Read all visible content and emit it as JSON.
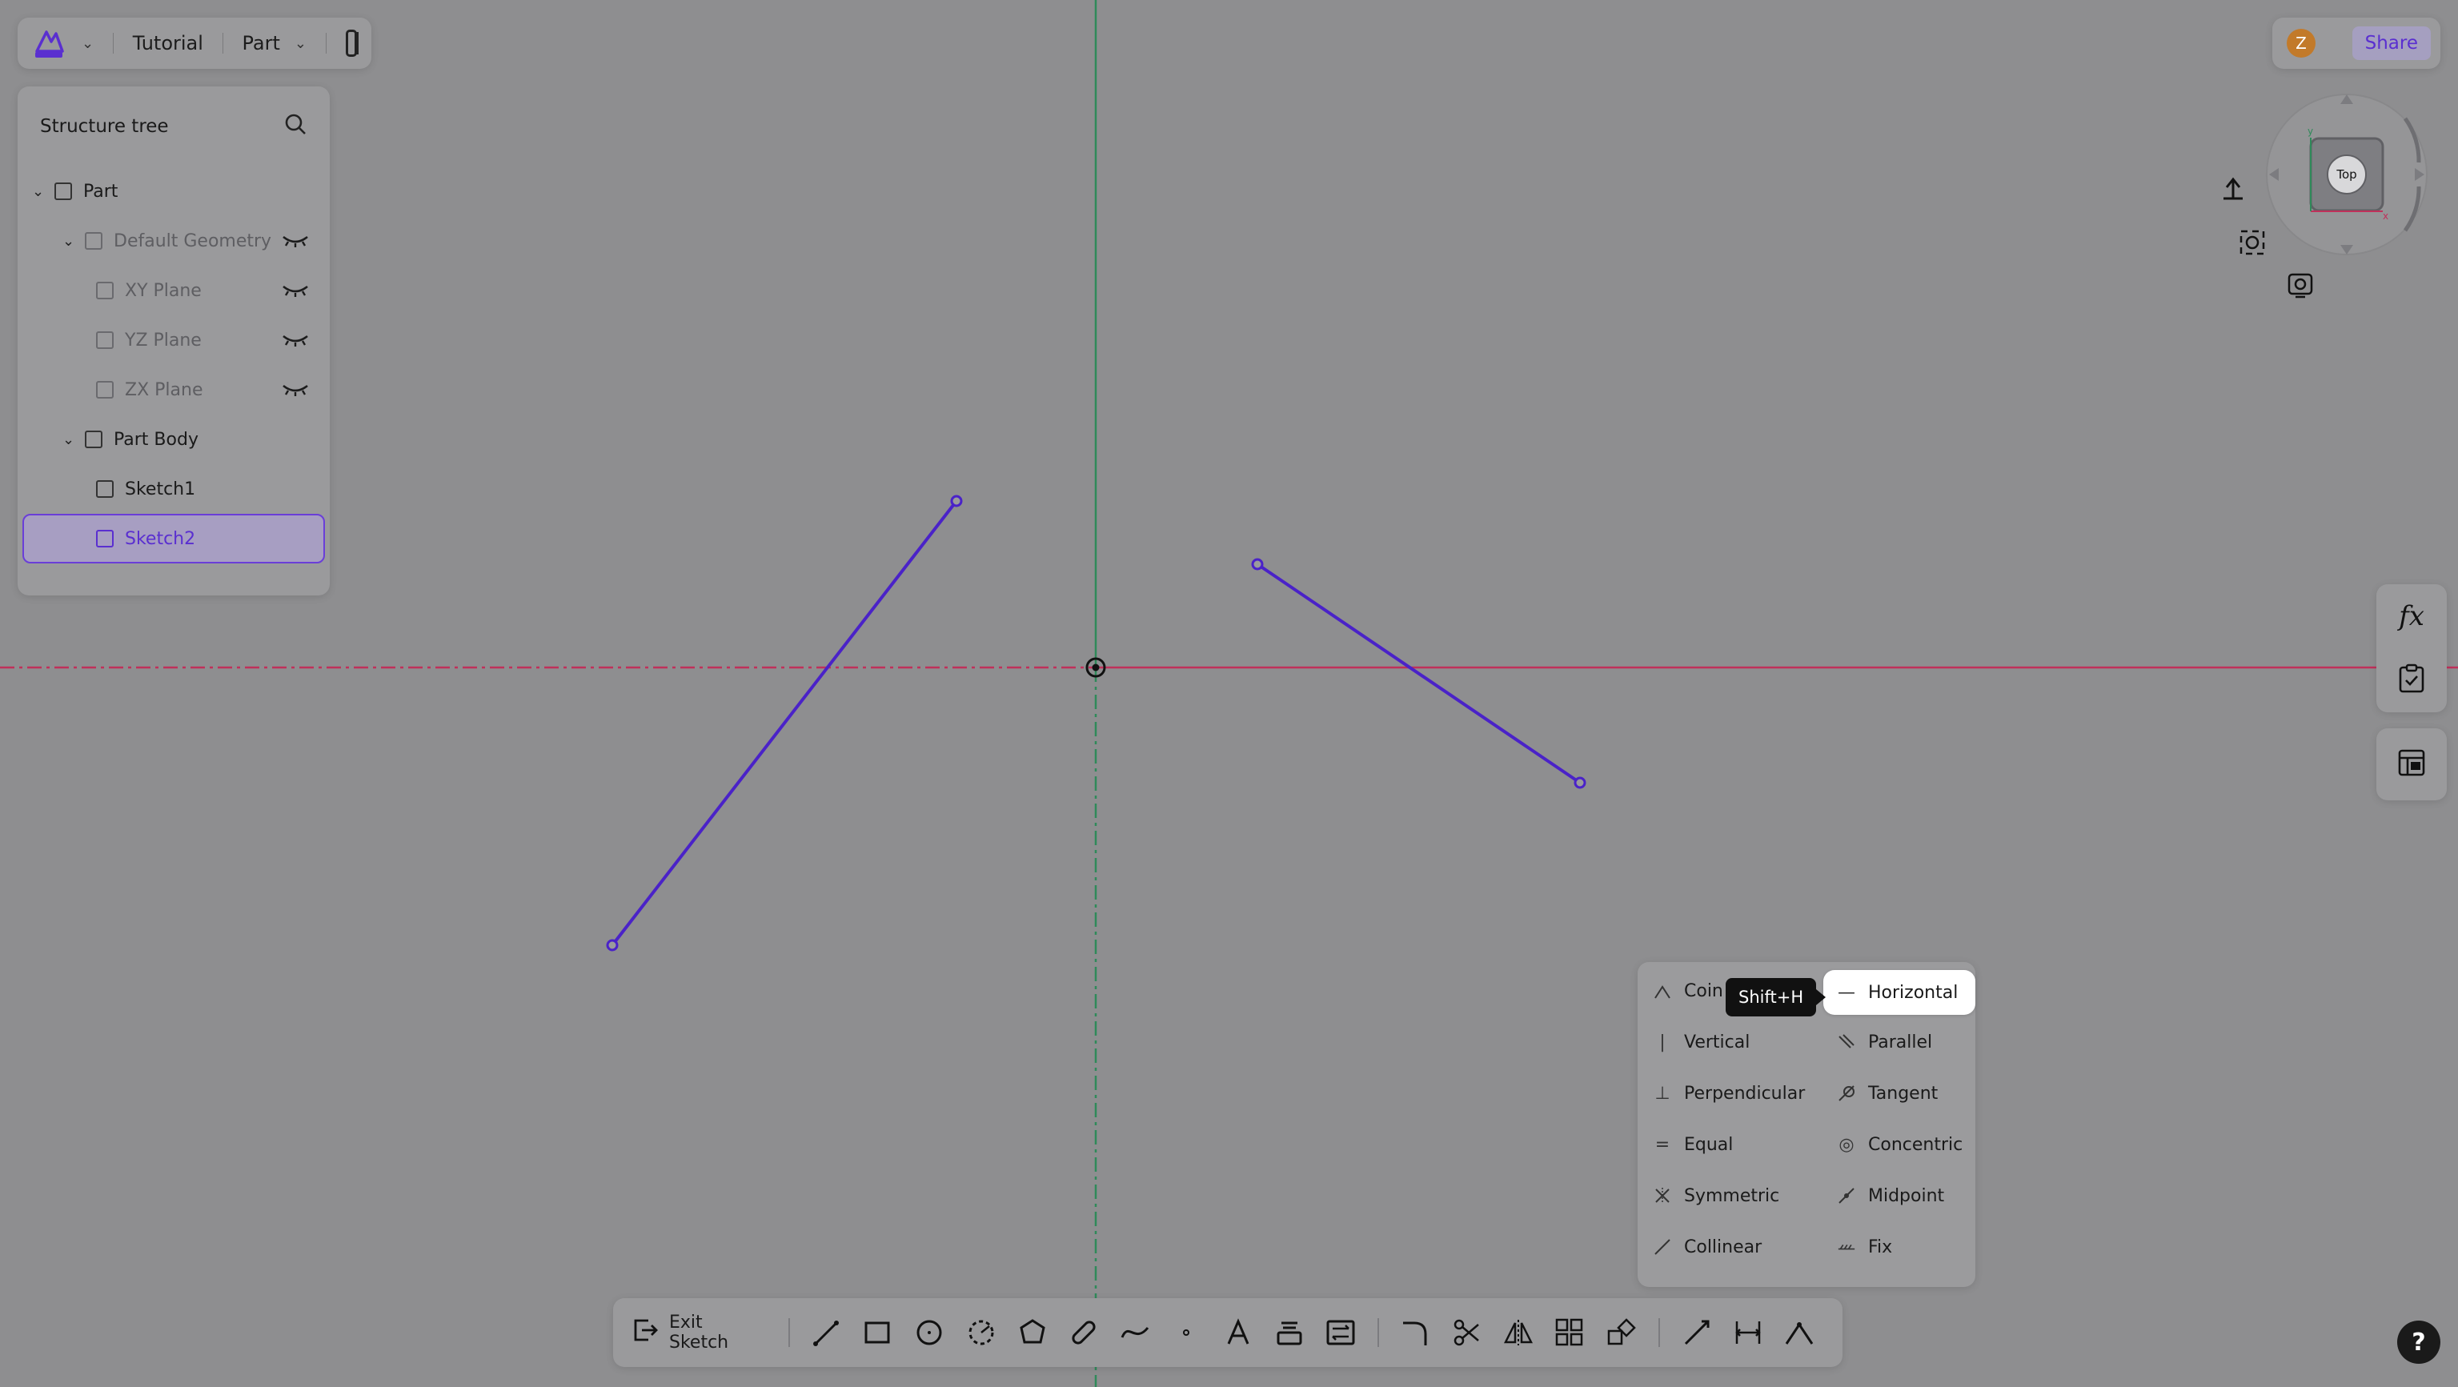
{
  "topbar": {
    "project": "Tutorial",
    "mode": "Part"
  },
  "tree": {
    "title": "Structure tree",
    "items": [
      {
        "label": "Part",
        "level": 0,
        "state": "normal"
      },
      {
        "label": "Default Geometry",
        "level": 1,
        "state": "dim"
      },
      {
        "label": "XY Plane",
        "level": 2,
        "state": "dim"
      },
      {
        "label": "YZ Plane",
        "level": 2,
        "state": "dim"
      },
      {
        "label": "ZX Plane",
        "level": 2,
        "state": "dim"
      },
      {
        "label": "Part Body",
        "level": 1,
        "state": "normal"
      },
      {
        "label": "Sketch1",
        "level": 2,
        "state": "normal"
      },
      {
        "label": "Sketch2",
        "level": 2,
        "state": "selected"
      }
    ]
  },
  "header": {
    "avatar_initial": "Z",
    "share_label": "Share"
  },
  "viewcube": {
    "face_label": "Top"
  },
  "constraint_menu": {
    "tooltip": "Shift+H",
    "items": [
      {
        "label": "Coin",
        "icon": "coincident-icon"
      },
      {
        "label": "Horizontal",
        "icon": "horizontal-icon"
      },
      {
        "label": "Vertical",
        "icon": "vertical-icon"
      },
      {
        "label": "Parallel",
        "icon": "parallel-icon"
      },
      {
        "label": "Perpendicular",
        "icon": "perpendicular-icon"
      },
      {
        "label": "Tangent",
        "icon": "tangent-icon"
      },
      {
        "label": "Equal",
        "icon": "equal-icon"
      },
      {
        "label": "Concentric",
        "icon": "concentric-icon"
      },
      {
        "label": "Symmetric",
        "icon": "symmetric-icon"
      },
      {
        "label": "Midpoint",
        "icon": "midpoint-icon"
      },
      {
        "label": "Collinear",
        "icon": "collinear-icon"
      },
      {
        "label": "Fix",
        "icon": "fix-icon"
      }
    ]
  },
  "toolbar": {
    "exit_label": "Exit Sketch"
  },
  "colors": {
    "sketch_line": "#4a22c8",
    "axis_x": "#c0305a",
    "axis_y": "#2f8a5a",
    "accent": "#5a2fd0"
  },
  "help_label": "?"
}
